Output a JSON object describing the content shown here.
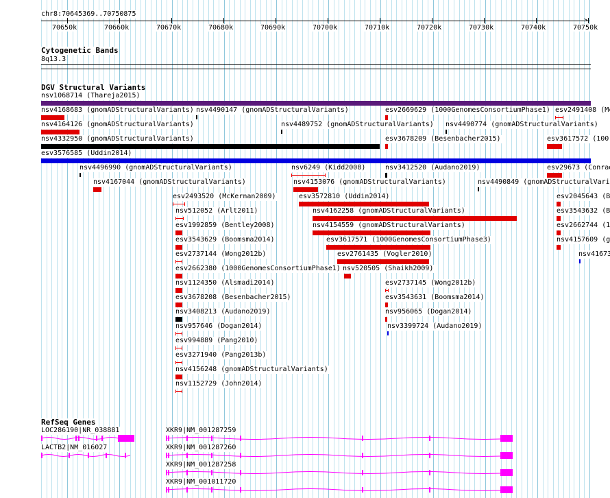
{
  "browser": {
    "position_text": "chr8:70645369..70750875",
    "ruler_ticks": [
      "70650k",
      "70660k",
      "70670k",
      "70680k",
      "70690k",
      "70700k",
      "70710k",
      "70720k",
      "70730k",
      "70740k",
      "70750k"
    ]
  },
  "tracks": {
    "cytoband": {
      "title": "Cytogenetic Bands",
      "band": "8q13.3"
    },
    "dgv": {
      "title": "DGV Structural Variants",
      "features": [
        {
          "label": "nsv1068714 (Thareja2015)"
        },
        {
          "label": "nsv4168683 (gnomADStructuralVariants)"
        },
        {
          "label": "nsv4490147 (gnomADStructuralVariants)"
        },
        {
          "label": "esv2669629 (1000GenomesConsortiumPhase1)"
        },
        {
          "label": "esv2491408 (Mc"
        },
        {
          "label": "nsv4164126 (gnomADStructuralVariants)"
        },
        {
          "label": "nsv4489752 (gnomADStructuralVariants)"
        },
        {
          "label": "nsv4490774 (gnomADStructuralVariants)"
        },
        {
          "label": "nsv4332950 (gnomADStructuralVariants)"
        },
        {
          "label": "esv3678209 (Besenbacher2015)"
        },
        {
          "label": "esv3617572 (100("
        },
        {
          "label": "esv3576585 (Uddin2014)"
        },
        {
          "label": "nsv4496990 (gnomADStructuralVariants)"
        },
        {
          "label": "nsv6249 (Kidd2008)"
        },
        {
          "label": "nsv3412520 (Audano2019)"
        },
        {
          "label": "esv29673 (Conrad"
        },
        {
          "label": "nsv4167044 (gnomADStructuralVariants)"
        },
        {
          "label": "nsv4153076 (gnomADStructuralVariants)"
        },
        {
          "label": "nsv4490849 (gnomADStructuralVaria"
        },
        {
          "label": "esv2493520 (McKernan2009)"
        },
        {
          "label": "esv3572810 (Uddin2014)"
        },
        {
          "label": "esv2045643 (B"
        },
        {
          "label": "nsv512052 (Arlt2011)"
        },
        {
          "label": "nsv4162258 (gnomADStructuralVariants)"
        },
        {
          "label": "esv3543632 (B"
        },
        {
          "label": "esv1992859 (Bentley2008)"
        },
        {
          "label": "nsv4154559 (gnomADStructuralVariants)"
        },
        {
          "label": "esv2662744 (1"
        },
        {
          "label": "esv3543629 (Boomsma2014)"
        },
        {
          "label": "esv3617571 (1000GenomesConsortiumPhase3)"
        },
        {
          "label": "nsv4157609 (g"
        },
        {
          "label": "esv2737144 (Wong2012b)"
        },
        {
          "label": "esv2761435 (Vogler2010)"
        },
        {
          "label": "nsv41673"
        },
        {
          "label": "esv2662380 (1000GenomesConsortiumPhase1)"
        },
        {
          "label": "nsv520505 (Shaikh2009)"
        },
        {
          "label": "nsv1124350 (Alsmadi2014)"
        },
        {
          "label": "esv2737145 (Wong2012b)"
        },
        {
          "label": "esv3678208 (Besenbacher2015)"
        },
        {
          "label": "esv3543631 (Boomsma2014)"
        },
        {
          "label": "nsv3408213 (Audano2019)"
        },
        {
          "label": "nsv956065 (Dogan2014)"
        },
        {
          "label": "nsv957646 (Dogan2014)"
        },
        {
          "label": "nsv3399724 (Audano2019)"
        },
        {
          "label": "esv994889 (Pang2010)"
        },
        {
          "label": "esv3271940 (Pang2013b)"
        },
        {
          "label": "nsv4156248 (gnomADStructuralVariants)"
        },
        {
          "label": "nsv1152729 (John2014)"
        }
      ]
    },
    "refseq": {
      "title": "RefSeq Genes",
      "genes": [
        {
          "label": "LOC286190|NR_038881"
        },
        {
          "label": "XKR9|NM_001287259"
        },
        {
          "label": "LACTB2|NM_016027"
        },
        {
          "label": "XKR9|NM_001287260"
        },
        {
          "label": "XKR9|NM_001287258"
        },
        {
          "label": "XKR9|NM_001011720"
        }
      ]
    }
  },
  "colors": {
    "loss": "#e00000",
    "gain": "#0000e0",
    "inversion": "#5a1a7a",
    "complex": "#000000",
    "gene": "#ff00ff",
    "grid": "#bfe3ee"
  }
}
